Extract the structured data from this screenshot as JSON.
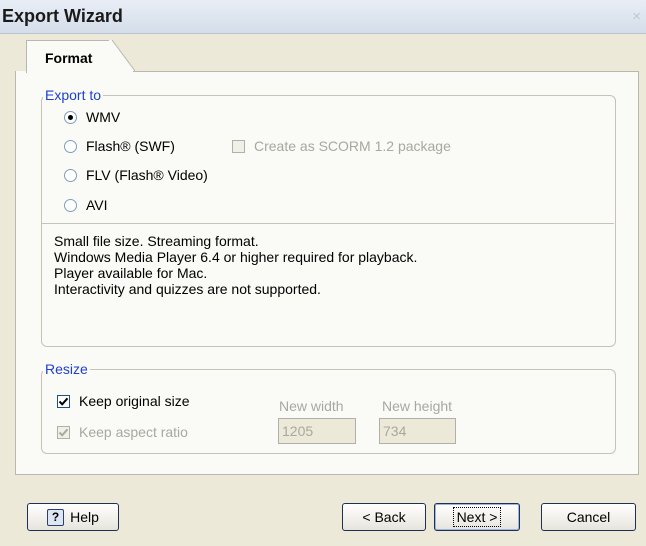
{
  "window": {
    "title": "Export Wizard",
    "close_glyph": "×"
  },
  "tabs": [
    {
      "label": "Format",
      "active": true
    }
  ],
  "export_to": {
    "legend": "Export to",
    "options": [
      {
        "label": "WMV",
        "selected": true
      },
      {
        "label": "Flash® (SWF)",
        "selected": false
      },
      {
        "label": "FLV (Flash® Video)",
        "selected": false
      },
      {
        "label": "AVI",
        "selected": false
      }
    ],
    "scorm_checkbox": {
      "label": "Create as SCORM 1.2 package",
      "checked": false,
      "enabled": false
    },
    "description": [
      "Small file size. Streaming format.",
      "Windows Media Player 6.4 or higher required for playback.",
      "Player available for Mac.",
      "Interactivity and quizzes are not supported."
    ]
  },
  "resize": {
    "legend": "Resize",
    "keep_original": {
      "label": "Keep original size",
      "checked": true
    },
    "keep_aspect": {
      "label": "Keep aspect ratio",
      "checked": true,
      "enabled": false
    },
    "new_width": {
      "label": "New width",
      "value": "1205"
    },
    "new_height": {
      "label": "New height",
      "value": "734"
    }
  },
  "buttons": {
    "help": "Help",
    "help_icon": "?",
    "back": "< Back",
    "next": "Next >",
    "cancel": "Cancel"
  },
  "colors": {
    "legend_text": "#1e40d0",
    "dialog_bg": "#ece9d8",
    "panel_bg": "#fafaf7"
  }
}
